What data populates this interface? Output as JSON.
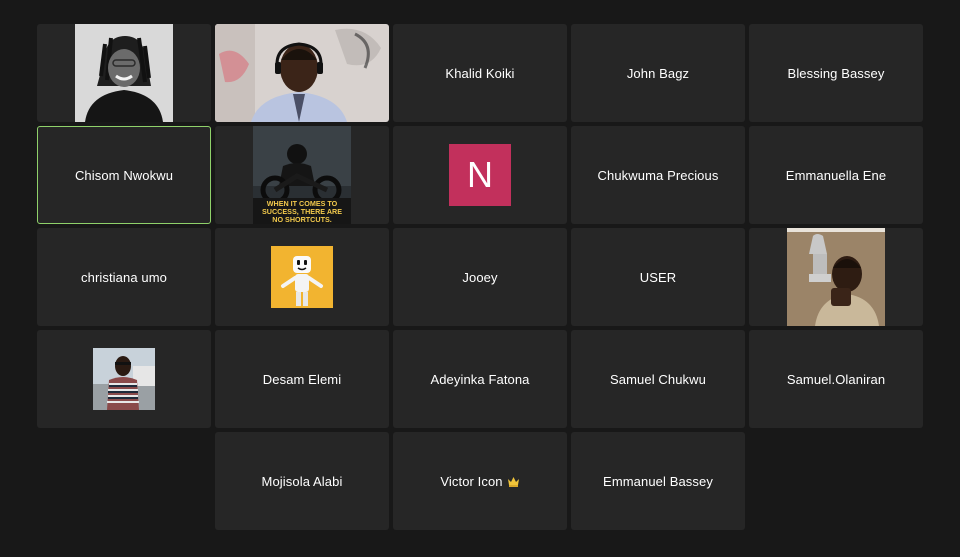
{
  "colors": {
    "background": "#181818",
    "tile": "#262626",
    "active_border": "#8fd16a",
    "avatar_n": "#c2305c",
    "text": "#ffffff"
  },
  "participants": [
    {
      "id": "p1",
      "name": "",
      "kind": "photo-grayscale-woman-dreadlocks"
    },
    {
      "id": "p2",
      "name": "",
      "kind": "live-video-man-headset"
    },
    {
      "id": "p3",
      "name": "Khalid Koiki",
      "kind": "name"
    },
    {
      "id": "p4",
      "name": "John Bagz",
      "kind": "name"
    },
    {
      "id": "p5",
      "name": "Blessing Bassey",
      "kind": "name"
    },
    {
      "id": "p6",
      "name": "Chisom Nwokwu",
      "kind": "name",
      "active_speaker": true
    },
    {
      "id": "p7",
      "name": "",
      "kind": "poster-motorcycle",
      "poster_text": "WHEN IT COMES TO SUCCESS, THERE ARE NO SHORTCUTS."
    },
    {
      "id": "p8",
      "name": "",
      "kind": "letter-avatar",
      "letter": "N"
    },
    {
      "id": "p9",
      "name": "Chukwuma Precious",
      "kind": "name"
    },
    {
      "id": "p10",
      "name": "Emmanuella Ene",
      "kind": "name"
    },
    {
      "id": "p11",
      "name": "christiana umo",
      "kind": "name"
    },
    {
      "id": "p12",
      "name": "",
      "kind": "image-marshmello"
    },
    {
      "id": "p13",
      "name": "Jooey",
      "kind": "name"
    },
    {
      "id": "p14",
      "name": "USER",
      "kind": "name"
    },
    {
      "id": "p15",
      "name": "",
      "kind": "photo-boy-trophy"
    },
    {
      "id": "p16",
      "name": "",
      "kind": "photo-man-striped-shirt"
    },
    {
      "id": "p17",
      "name": "Desam Elemi",
      "kind": "name"
    },
    {
      "id": "p18",
      "name": "Adeyinka Fatona",
      "kind": "name"
    },
    {
      "id": "p19",
      "name": "Samuel Chukwu",
      "kind": "name"
    },
    {
      "id": "p20",
      "name": "Samuel.Olaniran",
      "kind": "name"
    },
    {
      "id": "p21",
      "name": "Mojisola Alabi",
      "kind": "name"
    },
    {
      "id": "p22",
      "name": "Victor Icon",
      "kind": "name",
      "badge": "crown-emoji"
    },
    {
      "id": "p23",
      "name": "Emmanuel Bassey",
      "kind": "name"
    }
  ]
}
